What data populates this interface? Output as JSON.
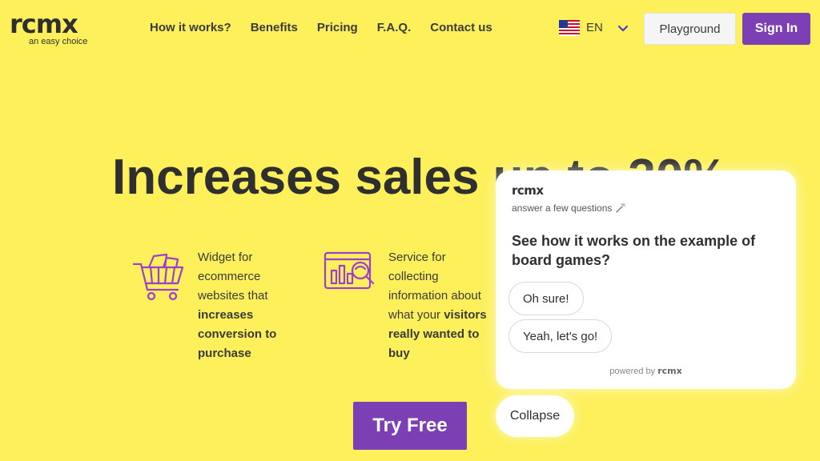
{
  "brand": {
    "logo_text": "rcmx",
    "tagline": "an easy choice"
  },
  "nav": {
    "items": [
      {
        "label": "How it works?"
      },
      {
        "label": "Benefits"
      },
      {
        "label": "Pricing"
      },
      {
        "label": "F.A.Q."
      },
      {
        "label": "Contact us"
      }
    ]
  },
  "language": {
    "code": "EN",
    "flag": "us-flag-icon"
  },
  "header_buttons": {
    "playground": "Playground",
    "signin": "Sign In"
  },
  "hero": {
    "title": "Increases sales up to 30%",
    "features": [
      {
        "icon": "shopping-cart-icon",
        "text_plain": "Widget for ecommerce websites that ",
        "text_bold": "increases conversion to purchase"
      },
      {
        "icon": "analytics-search-icon",
        "text_plain": "Service for collecting information about what your ",
        "text_bold": "visitors really wanted to buy"
      }
    ],
    "cta": "Try Free"
  },
  "widget": {
    "logo_text": "rcmx",
    "subtitle": "answer a few questions",
    "question": "See how it works on the example of board games?",
    "options": [
      "Oh sure!",
      "Yeah, let's go!"
    ],
    "powered_by": "powered by",
    "powered_logo": "rcmx",
    "collapse": "Collapse"
  },
  "colors": {
    "background": "#fdf05a",
    "accent": "#7c3fb4",
    "text": "#2f2f2f"
  }
}
